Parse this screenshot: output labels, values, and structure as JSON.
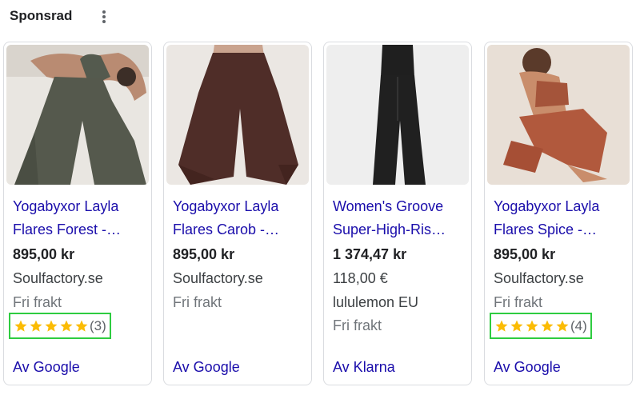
{
  "header": {
    "title": "Sponsrad"
  },
  "colors": {
    "link": "#1a0dab",
    "star": "#fbbc04",
    "highlight": "#2ecc40"
  },
  "cards": [
    {
      "title_line1": "Yogabyxor Layla",
      "title_line2": "Flares Forest -…",
      "price": "895,00 kr",
      "seller": "Soulfactory.se",
      "shipping": "Fri frakt",
      "rating": {
        "stars": 5,
        "count_label": "(3)"
      },
      "footer": "Av Google",
      "image": "model-in-green-flared-pants"
    },
    {
      "title_line1": "Yogabyxor Layla",
      "title_line2": "Flares Carob -…",
      "price": "895,00 kr",
      "seller": "Soulfactory.se",
      "shipping": "Fri frakt",
      "footer": "Av Google",
      "image": "brown-flared-pants"
    },
    {
      "title_line1": "Women's Groove",
      "title_line2": "Super-High-Ris…",
      "price": "1 374,47 kr",
      "alt_price": "118,00 €",
      "seller": "lululemon EU",
      "shipping": "Fri frakt",
      "footer": "Av Klarna",
      "image": "black-flared-pants"
    },
    {
      "title_line1": "Yogabyxor Layla",
      "title_line2": "Flares Spice -…",
      "price": "895,00 kr",
      "seller": "Soulfactory.se",
      "shipping": "Fri frakt",
      "rating": {
        "stars": 5,
        "count_label": "(4)"
      },
      "footer": "Av Google",
      "image": "model-seated-in-rust-set"
    }
  ]
}
